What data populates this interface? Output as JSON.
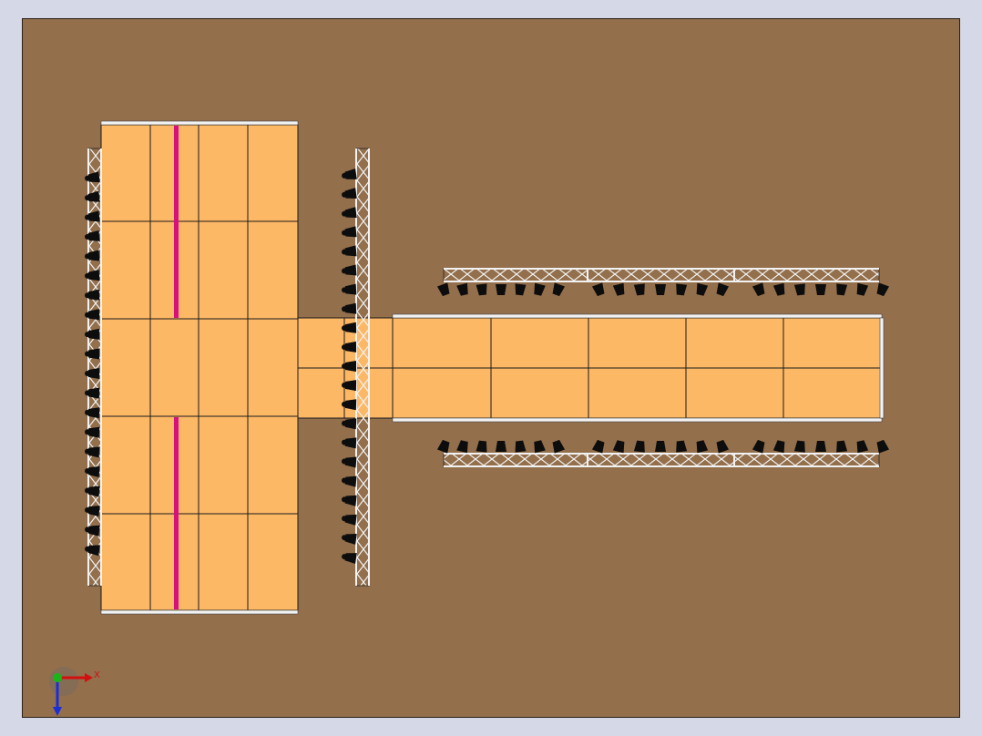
{
  "viewport": {
    "background_color": "#936f4c",
    "frame_color": "#d5d8e6"
  },
  "stage": {
    "panel_fill": "#fdb865",
    "panel_stroke": "#1a1a1a",
    "accent_strip_color": "#d8107e"
  },
  "truss": {
    "color": "#f2f2f2",
    "outline": "#222222"
  },
  "lights": {
    "color": "#0d0d0d"
  },
  "triad": {
    "x_label": "X",
    "x_color": "#d21010",
    "y_color": "#1bb51b",
    "z_color": "#1a2fd6"
  }
}
